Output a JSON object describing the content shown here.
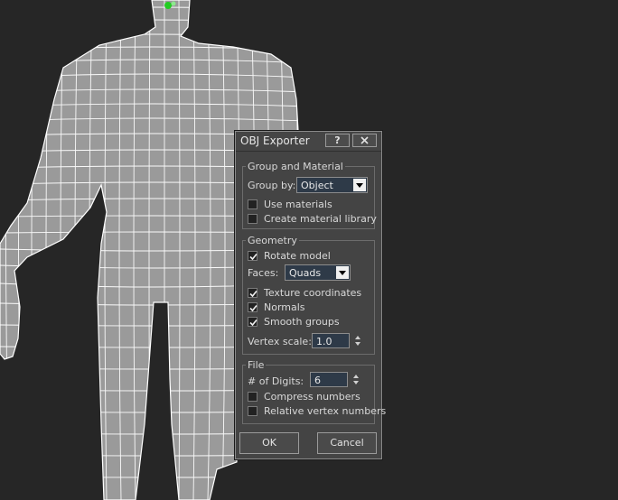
{
  "dialog": {
    "title": "OBJ Exporter",
    "help_button": "?",
    "group_material": {
      "title": "Group and Material",
      "group_by_label": "Group by:",
      "group_by_value": "Object",
      "use_materials": {
        "label": "Use materials",
        "checked": false
      },
      "create_library": {
        "label": "Create material library",
        "checked": false
      }
    },
    "geometry": {
      "title": "Geometry",
      "rotate_model": {
        "label": "Rotate model",
        "checked": true
      },
      "faces_label": "Faces:",
      "faces_value": "Quads",
      "texture_coords": {
        "label": "Texture coordinates",
        "checked": true
      },
      "normals": {
        "label": "Normals",
        "checked": true
      },
      "smooth_groups": {
        "label": "Smooth groups",
        "checked": true
      },
      "vertex_scale_label": "Vertex scale:",
      "vertex_scale_value": "1.0"
    },
    "file": {
      "title": "File",
      "digits_label": "# of Digits:",
      "digits_value": "6",
      "compress": {
        "label": "Compress numbers",
        "checked": false
      },
      "relative": {
        "label": "Relative vertex numbers",
        "checked": false
      }
    },
    "ok_label": "OK",
    "cancel_label": "Cancel"
  },
  "colors": {
    "viewport_bg": "#262626",
    "mesh_fill": "#9a9a9a",
    "wire": "#ffffff",
    "dialog_bg": "#444444",
    "field_bg": "#2e3a48",
    "gizmo": "#22cc22"
  }
}
